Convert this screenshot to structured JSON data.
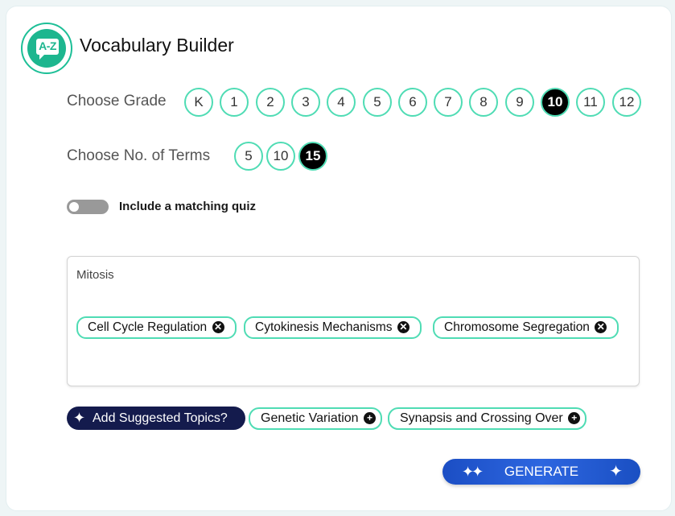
{
  "app": {
    "title": "Vocabulary Builder",
    "logo_text": "A-Z"
  },
  "grade": {
    "label": "Choose Grade",
    "options": [
      "K",
      "1",
      "2",
      "3",
      "4",
      "5",
      "6",
      "7",
      "8",
      "9",
      "10",
      "11",
      "12"
    ],
    "selected": "10"
  },
  "terms": {
    "label": "Choose No. of Terms",
    "options": [
      "5",
      "10",
      "15"
    ],
    "selected": "15"
  },
  "quiz_toggle": {
    "label": "Include a matching quiz",
    "enabled": false
  },
  "topic_input": {
    "value": "Mitosis",
    "chips": [
      "Cell Cycle Regulation",
      "Cytokinesis Mechanisms",
      "Chromosome Segregation"
    ]
  },
  "suggestions": {
    "button_label": "Add Suggested Topics?",
    "items": [
      "Genetic Variation",
      "Synapsis and Crossing Over"
    ]
  },
  "generate": {
    "label": "GENERATE"
  },
  "colors": {
    "accent": "#4fdcb4",
    "logo": "#1db68f",
    "suggest_button": "#141b4d",
    "generate_button": "#2d66e0",
    "selected_pill": "#000000"
  }
}
